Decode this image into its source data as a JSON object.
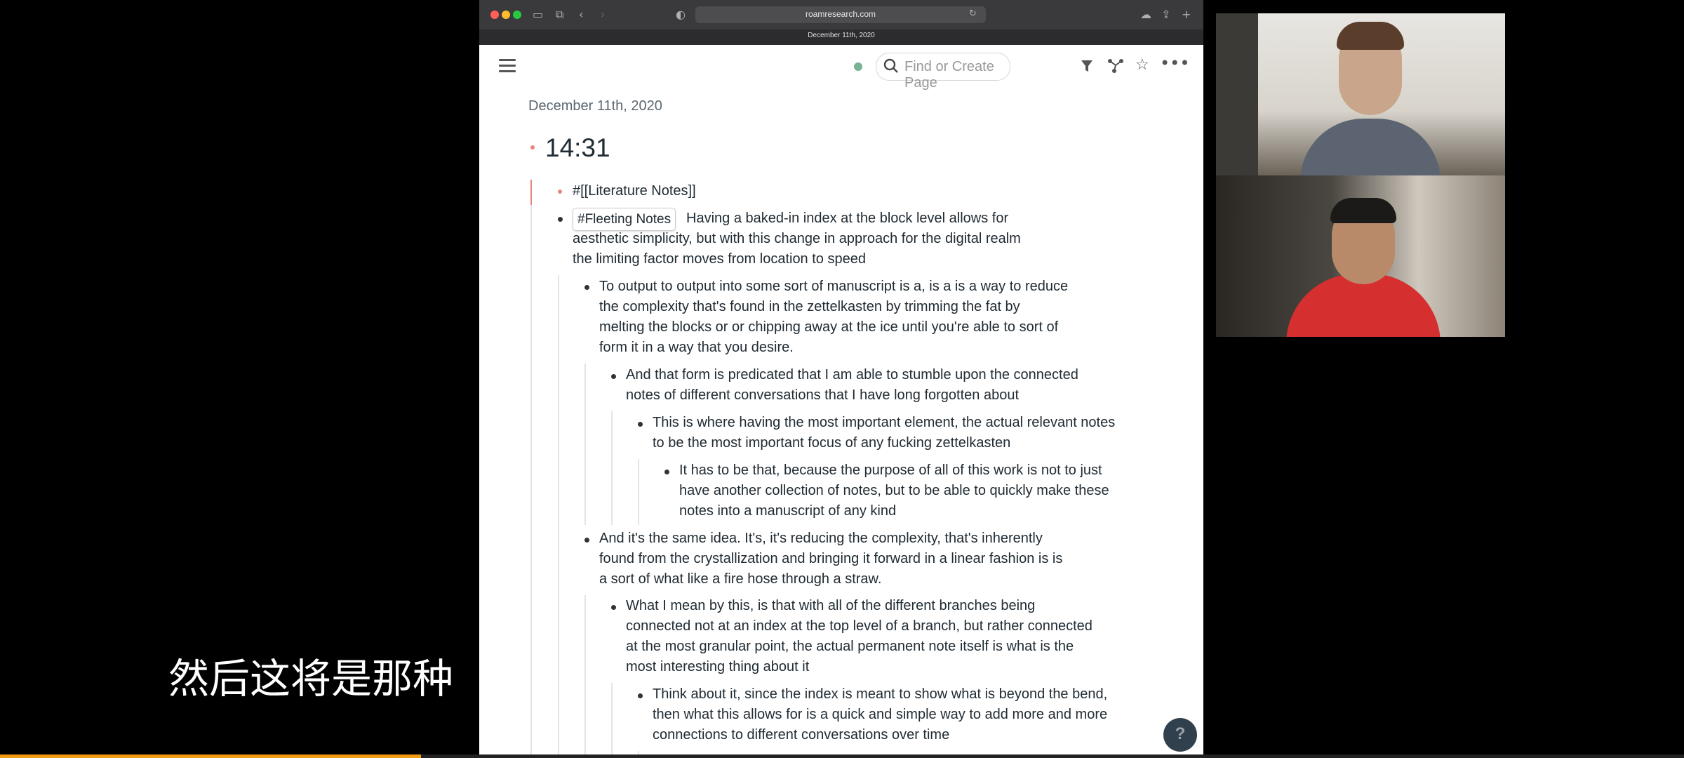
{
  "browser": {
    "url": "roamresearch.com",
    "tab_title": "December 11th, 2020",
    "icons": [
      "sidebar-icon",
      "tabs-icon",
      "back-icon",
      "forward-icon",
      "privacy-icon",
      "lock-icon",
      "reload-icon",
      "cloud-icon",
      "share-icon",
      "new-tab-icon"
    ]
  },
  "roam": {
    "search_placeholder": "Find or Create Page",
    "page_title": "December 11th, 2020",
    "heading": "14:31",
    "blocks": {
      "lit_notes": "#[[Literature Notes]]",
      "fleeting_tag": "#Fleeting Notes",
      "b1_l1": "Having a baked-in index at the block level allows for",
      "b1_l2": "aesthetic simplicity, but with this change in approach for the digital realm",
      "b1_l3": "the limiting factor moves from location to speed",
      "b2_l1": "To output to output into some sort of manuscript is a, is a is a way to reduce",
      "b2_l2": "the complexity that's found in the zettelkasten by trimming the fat by",
      "b2_l3": "melting the blocks or or chipping away at the ice until you're able to sort of",
      "b2_l4": "form it in a way that you desire.",
      "b3_l1": "And that form is predicated that I am able to stumble upon the connected",
      "b3_l2": "notes of different conversations that I have long forgotten about",
      "b4_l1": "This is where having the most important element, the actual relevant notes",
      "b4_l2": "to be the most important focus of any fucking zettelkasten",
      "b5_l1": "It has to be that, because the purpose of all of this work is not to just",
      "b5_l2": "have another collection of notes, but to be able to quickly make these",
      "b5_l3": "notes into a manuscript of any kind",
      "b6_l1": "And it's the same idea. It's, it's reducing the complexity, that's inherently",
      "b6_l2": "found from the crystallization and bringing it forward in a linear fashion is is",
      "b6_l3": "a sort of what like a fire hose through a straw.",
      "b7_l1": "What I mean by this, is that with all of the different branches being",
      "b7_l2": "connected not at an index at the top level of a branch, but rather connected",
      "b7_l3": "at the most granular point, the actual permanent note itself is what is the",
      "b7_l4": "most interesting thing about it",
      "b8_l1": "Think about it, since the index is meant to show what is beyond the bend,",
      "b8_l2": "then what this allows for is a quick and simple way to add more and more",
      "b8_l3": "connections to different conversations over time"
    },
    "help_label": "?"
  },
  "subtitle": "然后这将是那种",
  "video_progress": 0.25,
  "colors": {
    "accent_bullet": "#e8857a",
    "sync": "#79b391",
    "progress": "#f39c12"
  }
}
